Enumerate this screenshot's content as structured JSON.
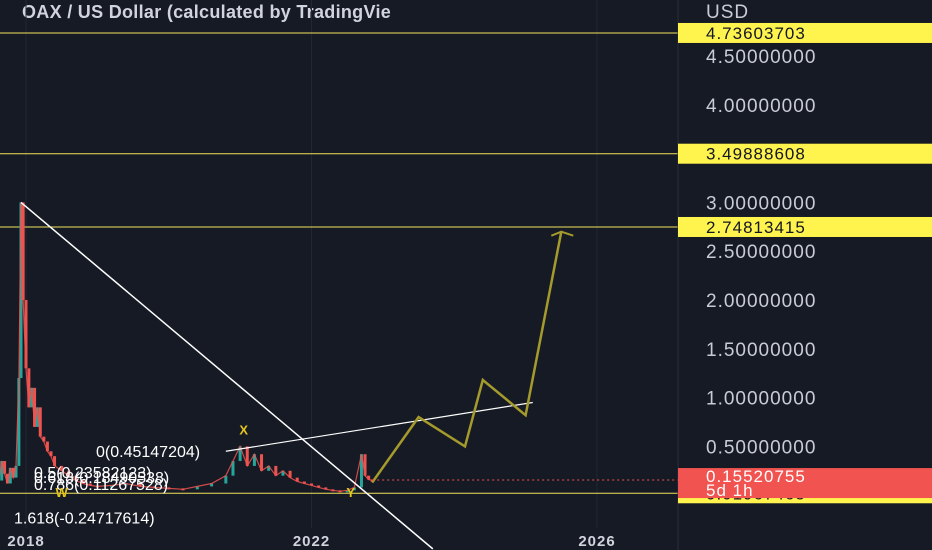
{
  "chart_data": {
    "type": "line",
    "title": "OAX / US Dollar (calculated by TradingVie",
    "currency": "USD",
    "y_ticks": [
      {
        "value": 4.5,
        "label": "4.50000000"
      },
      {
        "value": 4.0,
        "label": "4.00000000"
      },
      {
        "value": 3.0,
        "label": "3.00000000"
      },
      {
        "value": 2.5,
        "label": "2.50000000"
      },
      {
        "value": 2.0,
        "label": "2.00000000"
      },
      {
        "value": 1.5,
        "label": "1.50000000"
      },
      {
        "value": 1.0,
        "label": "1.00000000"
      },
      {
        "value": 0.5,
        "label": "0.50000000"
      }
    ],
    "x_ticks": [
      {
        "year": 2018,
        "label": "2018"
      },
      {
        "year": 2022,
        "label": "2022"
      },
      {
        "year": 2026,
        "label": "2026"
      }
    ],
    "ylim": [
      -0.5,
      4.98
    ],
    "xlim": [
      2017.6,
      2027.2
    ],
    "horizontal_levels": [
      {
        "value": 4.73603703,
        "label": "4.73603703"
      },
      {
        "value": 3.49888608,
        "label": "3.49888608"
      },
      {
        "value": 2.74813415,
        "label": "2.74813415"
      },
      {
        "value": 0.01967465,
        "label": "0.01967465"
      }
    ],
    "current_price": {
      "value": 0.15520755,
      "label": "0.15520755",
      "countdown": "5d 1h"
    },
    "price_series": [
      [
        2017.62,
        0.15
      ],
      [
        2017.66,
        0.35
      ],
      [
        2017.7,
        0.22
      ],
      [
        2017.74,
        0.12
      ],
      [
        2017.78,
        0.28
      ],
      [
        2017.82,
        0.18
      ],
      [
        2017.86,
        0.3
      ],
      [
        2017.9,
        1.2
      ],
      [
        2017.93,
        3.0
      ],
      [
        2017.96,
        2.0
      ],
      [
        2018.0,
        1.3
      ],
      [
        2018.04,
        0.9
      ],
      [
        2018.08,
        1.1
      ],
      [
        2018.12,
        0.7
      ],
      [
        2018.16,
        0.9
      ],
      [
        2018.2,
        0.6
      ],
      [
        2018.25,
        0.55
      ],
      [
        2018.3,
        0.45
      ],
      [
        2018.35,
        0.4
      ],
      [
        2018.4,
        0.3
      ],
      [
        2018.5,
        0.25
      ],
      [
        2018.6,
        0.2
      ],
      [
        2018.7,
        0.15
      ],
      [
        2018.8,
        0.12
      ],
      [
        2018.9,
        0.1
      ],
      [
        2019.0,
        0.09
      ],
      [
        2019.2,
        0.1
      ],
      [
        2019.4,
        0.12
      ],
      [
        2019.6,
        0.09
      ],
      [
        2019.8,
        0.08
      ],
      [
        2020.0,
        0.07
      ],
      [
        2020.2,
        0.06
      ],
      [
        2020.4,
        0.09
      ],
      [
        2020.6,
        0.12
      ],
      [
        2020.8,
        0.2
      ],
      [
        2020.9,
        0.35
      ],
      [
        2021.0,
        0.5
      ],
      [
        2021.1,
        0.3
      ],
      [
        2021.2,
        0.42
      ],
      [
        2021.3,
        0.25
      ],
      [
        2021.4,
        0.3
      ],
      [
        2021.5,
        0.2
      ],
      [
        2021.6,
        0.25
      ],
      [
        2021.7,
        0.18
      ],
      [
        2021.8,
        0.14
      ],
      [
        2021.9,
        0.12
      ],
      [
        2022.0,
        0.1
      ],
      [
        2022.1,
        0.08
      ],
      [
        2022.2,
        0.06
      ],
      [
        2022.3,
        0.05
      ],
      [
        2022.4,
        0.04
      ],
      [
        2022.5,
        0.05
      ],
      [
        2022.6,
        0.08
      ],
      [
        2022.7,
        0.42
      ],
      [
        2022.75,
        0.2
      ],
      [
        2022.8,
        0.16
      ],
      [
        2022.85,
        0.155
      ]
    ],
    "projection_path": [
      [
        2022.85,
        0.13
      ],
      [
        2023.5,
        0.8
      ],
      [
        2024.15,
        0.5
      ],
      [
        2024.4,
        1.18
      ],
      [
        2025.0,
        0.82
      ],
      [
        2025.5,
        2.7
      ]
    ],
    "trendlines": [
      {
        "name": "descending",
        "points": [
          [
            2017.93,
            3.0
          ],
          [
            2023.7,
            -0.55
          ]
        ]
      },
      {
        "name": "ascending",
        "points": [
          [
            2020.8,
            0.45
          ],
          [
            2025.1,
            0.95
          ]
        ]
      }
    ],
    "fib_levels": [
      {
        "label": "0(0.45147204)",
        "value": 0.45147204
      },
      {
        "label": "0.5(0.23582123)",
        "value": 0.23582123
      },
      {
        "label": "0.618(0.18490538)",
        "value": 0.18490538
      },
      {
        "label": "0.786(0.11267528)",
        "value": 0.11267528
      },
      {
        "label": "1.618(-0.24717614)",
        "value": -0.24717614
      }
    ],
    "wave_labels": [
      {
        "label": "W",
        "x": 2018.5,
        "y": -0.02
      },
      {
        "label": "X",
        "x": 2021.05,
        "y": 0.62
      },
      {
        "label": "Y",
        "x": 2022.55,
        "y": -0.02
      }
    ],
    "colors": {
      "background": "#161a25",
      "candles_up": "#26a69a",
      "candles_down": "#ef5350",
      "level_line": "#f2e35a",
      "level_tag": "#fff34d",
      "projection": "#a59a2c",
      "trendline": "#ffffff",
      "price_tag": "#f05350"
    }
  }
}
